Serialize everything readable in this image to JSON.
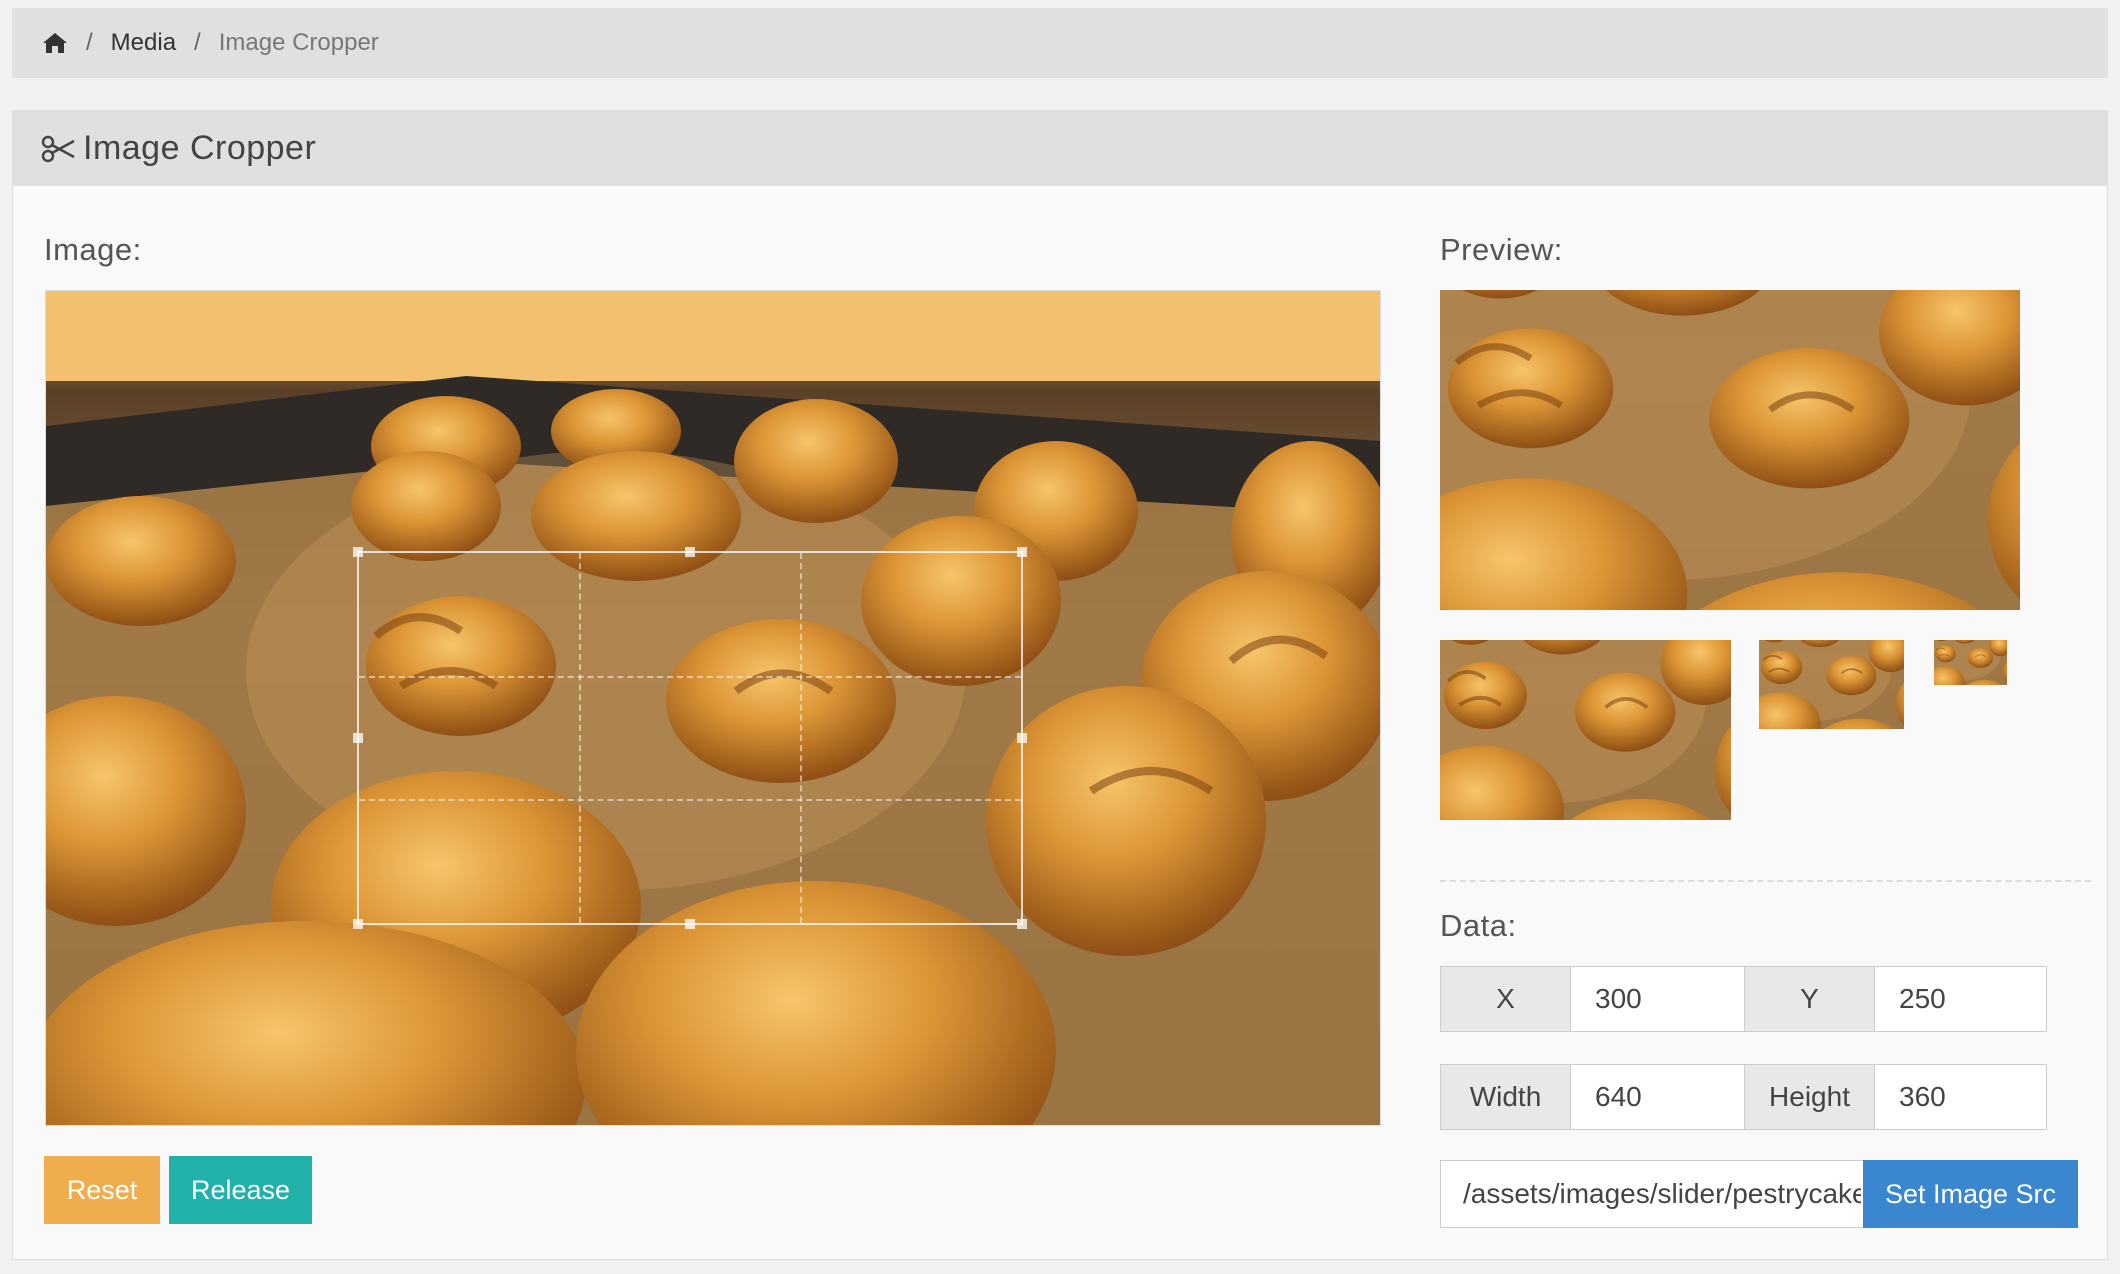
{
  "breadcrumb": {
    "home_icon": "home-icon",
    "separator": "/",
    "items": [
      "Media",
      "Image Cropper"
    ]
  },
  "panel": {
    "icon": "scissors-icon",
    "title": "Image Cropper"
  },
  "image_section": {
    "label": "Image:"
  },
  "preview_section": {
    "label": "Preview:"
  },
  "data_section": {
    "label": "Data:",
    "x_label": "X",
    "x_value": "300",
    "y_label": "Y",
    "y_value": "250",
    "width_label": "Width",
    "width_value": "640",
    "height_label": "Height",
    "height_value": "360"
  },
  "buttons": {
    "reset": "Reset",
    "release": "Release",
    "set_src": "Set Image Src"
  },
  "image_src": {
    "value": "/assets/images/slider/pestrycake.jpg"
  },
  "colors": {
    "reset": "#f0ad4e",
    "release": "#20b2aa",
    "set_src": "#3a87d0"
  }
}
